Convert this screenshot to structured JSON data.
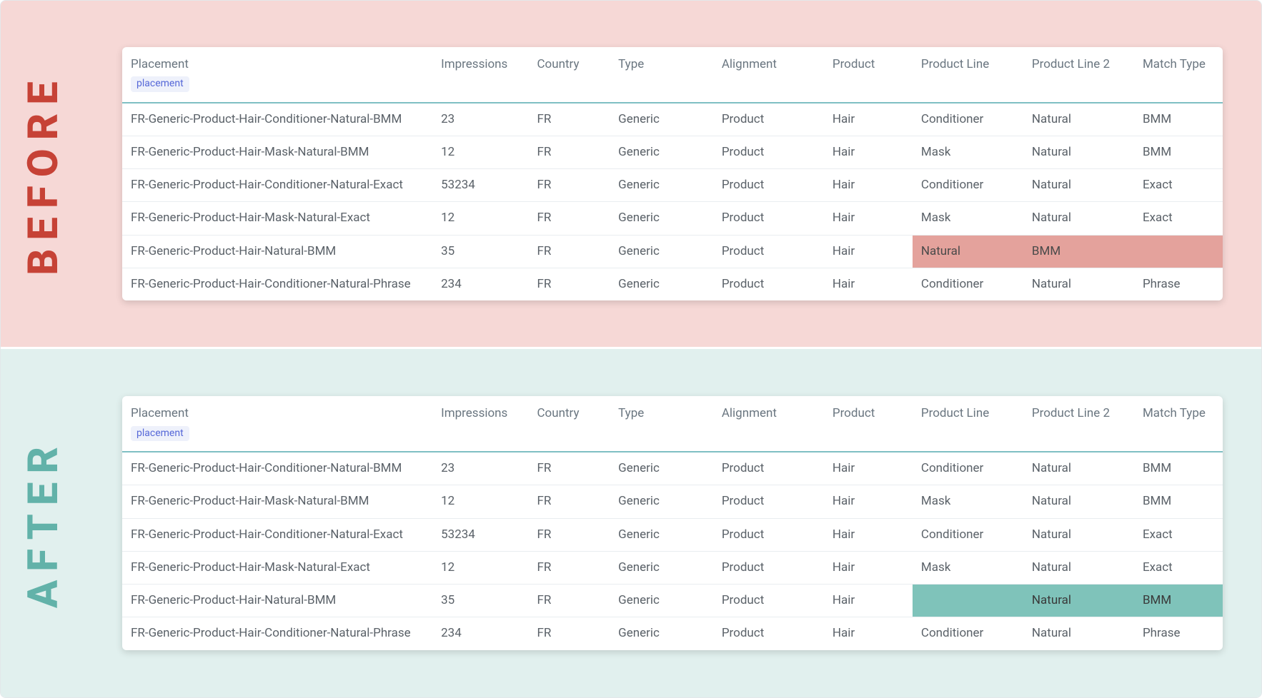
{
  "labels": {
    "before": "BEFORE",
    "after": "AFTER"
  },
  "table": {
    "header": {
      "placement": "Placement",
      "placement_pill": "placement",
      "impressions": "Impressions",
      "country": "Country",
      "type": "Type",
      "alignment": "Alignment",
      "product": "Product",
      "product_line": "Product Line",
      "product_line_2": "Product Line 2",
      "match_type": "Match Type"
    }
  },
  "before": {
    "rows": [
      {
        "placement": "FR-Generic-Product-Hair-Conditioner-Natural-BMM",
        "impressions": "23",
        "country": "FR",
        "type": "Generic",
        "alignment": "Product",
        "product": "Hair",
        "product_line": "Conditioner",
        "product_line_2": "Natural",
        "match_type": "BMM",
        "hl": []
      },
      {
        "placement": "FR-Generic-Product-Hair-Mask-Natural-BMM",
        "impressions": "12",
        "country": "FR",
        "type": "Generic",
        "alignment": "Product",
        "product": "Hair",
        "product_line": "Mask",
        "product_line_2": "Natural",
        "match_type": "BMM",
        "hl": []
      },
      {
        "placement": "FR-Generic-Product-Hair-Conditioner-Natural-Exact",
        "impressions": "53234",
        "country": "FR",
        "type": "Generic",
        "alignment": "Product",
        "product": "Hair",
        "product_line": "Conditioner",
        "product_line_2": "Natural",
        "match_type": "Exact",
        "hl": []
      },
      {
        "placement": "FR-Generic-Product-Hair-Mask-Natural-Exact",
        "impressions": "12",
        "country": "FR",
        "type": "Generic",
        "alignment": "Product",
        "product": "Hair",
        "product_line": "Mask",
        "product_line_2": "Natural",
        "match_type": "Exact",
        "hl": []
      },
      {
        "placement": "FR-Generic-Product-Hair-Natural-BMM",
        "impressions": "35",
        "country": "FR",
        "type": "Generic",
        "alignment": "Product",
        "product": "Hair",
        "product_line": "Natural",
        "product_line_2": "BMM",
        "match_type": "",
        "hl": [
          "product_line",
          "product_line_2",
          "match_type"
        ]
      },
      {
        "placement": "FR-Generic-Product-Hair-Conditioner-Natural-Phrase",
        "impressions": "234",
        "country": "FR",
        "type": "Generic",
        "alignment": "Product",
        "product": "Hair",
        "product_line": "Conditioner",
        "product_line_2": "Natural",
        "match_type": "Phrase",
        "hl": []
      }
    ],
    "hl_class": "hl-red"
  },
  "after": {
    "rows": [
      {
        "placement": "FR-Generic-Product-Hair-Conditioner-Natural-BMM",
        "impressions": "23",
        "country": "FR",
        "type": "Generic",
        "alignment": "Product",
        "product": "Hair",
        "product_line": "Conditioner",
        "product_line_2": "Natural",
        "match_type": "BMM",
        "hl": []
      },
      {
        "placement": "FR-Generic-Product-Hair-Mask-Natural-BMM",
        "impressions": "12",
        "country": "FR",
        "type": "Generic",
        "alignment": "Product",
        "product": "Hair",
        "product_line": "Mask",
        "product_line_2": "Natural",
        "match_type": "BMM",
        "hl": []
      },
      {
        "placement": "FR-Generic-Product-Hair-Conditioner-Natural-Exact",
        "impressions": "53234",
        "country": "FR",
        "type": "Generic",
        "alignment": "Product",
        "product": "Hair",
        "product_line": "Conditioner",
        "product_line_2": "Natural",
        "match_type": "Exact",
        "hl": []
      },
      {
        "placement": "FR-Generic-Product-Hair-Mask-Natural-Exact",
        "impressions": "12",
        "country": "FR",
        "type": "Generic",
        "alignment": "Product",
        "product": "Hair",
        "product_line": "Mask",
        "product_line_2": "Natural",
        "match_type": "Exact",
        "hl": []
      },
      {
        "placement": "FR-Generic-Product-Hair-Natural-BMM",
        "impressions": "35",
        "country": "FR",
        "type": "Generic",
        "alignment": "Product",
        "product": "Hair",
        "product_line": "",
        "product_line_2": "Natural",
        "match_type": "BMM",
        "hl": [
          "product_line",
          "product_line_2",
          "match_type"
        ]
      },
      {
        "placement": "FR-Generic-Product-Hair-Conditioner-Natural-Phrase",
        "impressions": "234",
        "country": "FR",
        "type": "Generic",
        "alignment": "Product",
        "product": "Hair",
        "product_line": "Conditioner",
        "product_line_2": "Natural",
        "match_type": "Phrase",
        "hl": []
      }
    ],
    "hl_class": "hl-teal"
  },
  "col_keys": [
    "placement",
    "impressions",
    "country",
    "type",
    "alignment",
    "product",
    "product_line",
    "product_line_2",
    "match_type"
  ]
}
